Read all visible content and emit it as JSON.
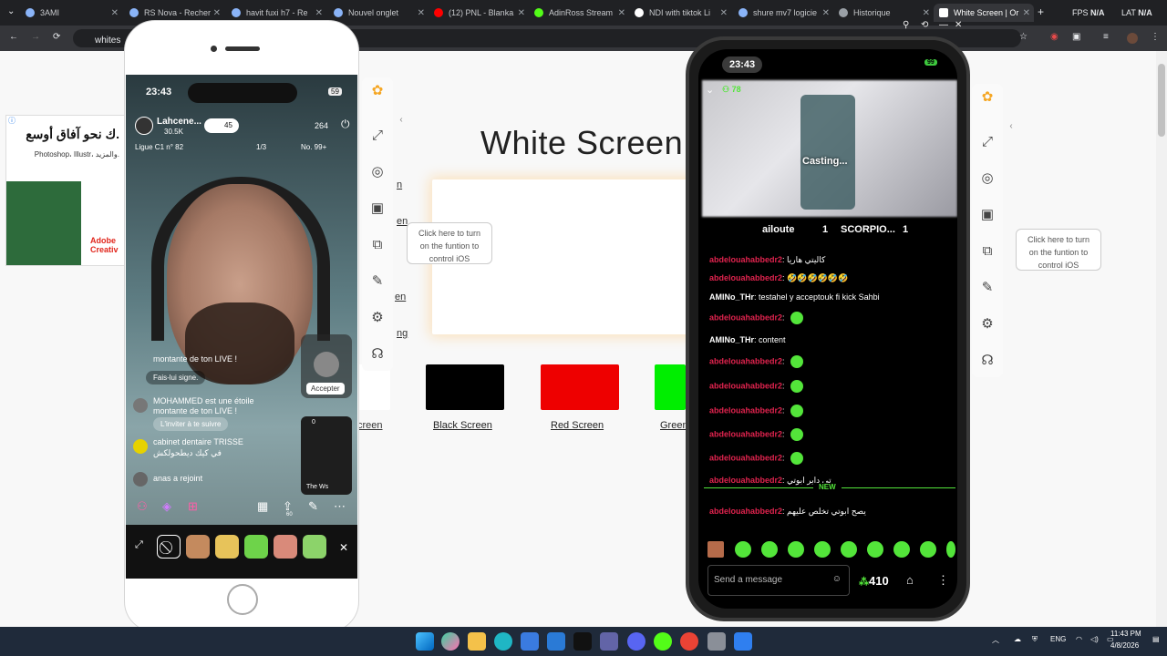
{
  "browser": {
    "tabs": [
      {
        "label": "3AMI",
        "active": false
      },
      {
        "label": "RS Nova - Recher",
        "active": false
      },
      {
        "label": "havit fuxi h7 - Re",
        "active": false
      },
      {
        "label": "Nouvel onglet",
        "active": false
      },
      {
        "label": "(12) PNL - Blanka",
        "active": false
      },
      {
        "label": "AdinRoss Stream",
        "active": false
      },
      {
        "label": "NDI with tiktok Li",
        "active": false
      },
      {
        "label": "shure mv7 logicie",
        "active": false
      },
      {
        "label": "Historique",
        "active": false
      },
      {
        "label": "White Screen | Or",
        "active": true
      }
    ],
    "address": "whites",
    "fps_label": "FPS",
    "fps_value": "N/A",
    "lat_label": "LAT",
    "lat_value": "N/A"
  },
  "page": {
    "title": "White Screen",
    "swatches": [
      {
        "label": "Black Screen",
        "color": "#000000"
      },
      {
        "label": "Red Screen",
        "color": "#ee0000"
      },
      {
        "label": "Green",
        "color": "#00ee00"
      }
    ],
    "partial_white_label": "creen",
    "partial_links": [
      "n",
      "en",
      "en",
      "ng"
    ]
  },
  "ad": {
    "headline": "ك نحو آفاق أوسع.",
    "sub": "Photoshop، Illustr، والمزيد.",
    "brand_line1": "Adobe",
    "brand_line2": "Creativ"
  },
  "side_tools": {
    "tooltip": "Click here to turn on the funtion to control iOS",
    "icons": [
      "fullscreen-icon",
      "camera-icon",
      "video-camera-icon",
      "screen-control-icon",
      "brush-icon",
      "settings-icon",
      "headset-icon"
    ]
  },
  "phone_left": {
    "time": "23:43",
    "battery": "59",
    "host_name": "Lahcene...",
    "host_followers": "30.5K",
    "likes": "45",
    "viewers": "264",
    "viewer_badge": "6",
    "league": "Ligue C1 n° 82",
    "rank": "1/3",
    "rank_no": "No. 99+",
    "comments": [
      {
        "text": "montante de ton LIVE !"
      },
      {
        "text": "Fais-lui signe."
      },
      {
        "user": "MOHAMMED",
        "text": "est une étoile montante de ton LIVE !",
        "cta": "L'inviter à te suivre"
      },
      {
        "user": "cabinet dentaire TRISSE",
        "text": "في كيك ديطحولكش"
      },
      {
        "user": "anas",
        "text": "a rejoint"
      }
    ],
    "accept_button": "Accepter",
    "mini_live_viewers": "0",
    "mini_live_name": "The Ws",
    "share_count": "60"
  },
  "phone_right": {
    "time": "23:43",
    "battery": "99",
    "viewers": "78",
    "casting": "Casting...",
    "battle_left": "ailoute",
    "battle_left_score": "1",
    "battle_right": "SCORPIO...",
    "battle_right_score": "1",
    "chat": [
      {
        "user": "abdelouahabbedr2",
        "msg": "كاليتي هاريا",
        "emotes": 0
      },
      {
        "user": "abdelouahabbedr2",
        "msg": "🤣🤣🤣🤣🤣🤣",
        "emotes": 0
      },
      {
        "user": "AMINo_THr",
        "msg": "testahel y acceptouk fi kick Sahbi",
        "emotes": 0,
        "white": true
      },
      {
        "user": "abdelouahabbedr2",
        "msg": "",
        "emotes": 1
      },
      {
        "user": "AMINo_THr",
        "msg": "content",
        "emotes": 0,
        "white": true
      },
      {
        "user": "abdelouahabbedr2",
        "msg": "",
        "emotes": 1
      },
      {
        "user": "abdelouahabbedr2",
        "msg": "",
        "emotes": 1
      },
      {
        "user": "abdelouahabbedr2",
        "msg": "",
        "emotes": 1
      },
      {
        "user": "abdelouahabbedr2",
        "msg": "",
        "emotes": 1
      },
      {
        "user": "abdelouahabbedr2",
        "msg": "",
        "emotes": 1
      },
      {
        "user": "abdelouahabbedr2",
        "msg": "تي داير ابوتي",
        "emotes": 0
      }
    ],
    "new_label": "NEW",
    "last_msg_user": "abdelouahabbedr2",
    "last_msg": "يصح ابوتي تخلص عليهم",
    "send_placeholder": "Send a message",
    "points": "410"
  },
  "taskbar": {
    "lang": "ENG",
    "time": "11:43 PM",
    "date": "4/8/2026"
  },
  "colors": {
    "accent_green": "#53e53a",
    "chat_red": "#e0234e"
  }
}
